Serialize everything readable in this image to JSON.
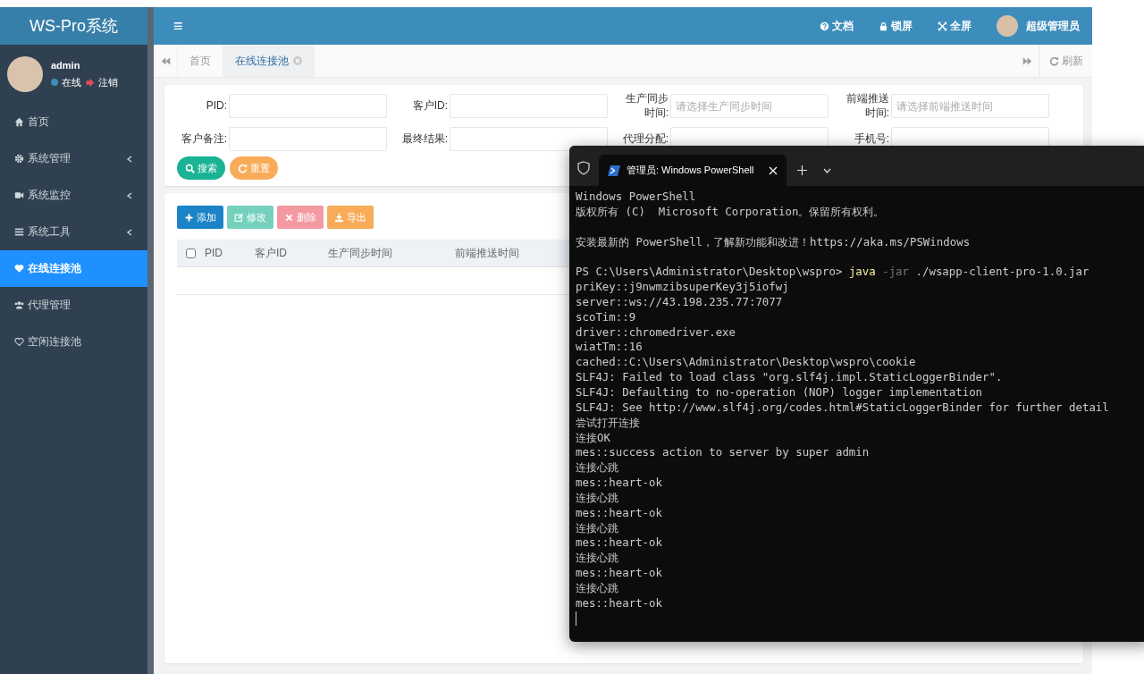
{
  "app": {
    "title": "WS-Pro系统"
  },
  "top_bar": {
    "menu_icon": "≡",
    "items": [
      {
        "kind": "docs",
        "label": "文档"
      },
      {
        "kind": "lock",
        "label": "锁屏"
      },
      {
        "kind": "fullscreen",
        "label": "全屏"
      },
      {
        "kind": "user",
        "label": "超级管理员"
      }
    ]
  },
  "user_panel": {
    "name": "admin",
    "status": "在线",
    "logout": "注销"
  },
  "sidebar": {
    "items": [
      {
        "kind": "home",
        "label": "首页",
        "expandable": false,
        "selected": false
      },
      {
        "kind": "gear",
        "label": "系统管理",
        "expandable": true,
        "selected": false
      },
      {
        "kind": "video",
        "label": "系统监控",
        "expandable": true,
        "selected": false
      },
      {
        "kind": "bars",
        "label": "系统工具",
        "expandable": true,
        "selected": false
      },
      {
        "kind": "heart",
        "label": "在线连接池",
        "expandable": false,
        "selected": true
      },
      {
        "kind": "users",
        "label": "代理管理",
        "expandable": false,
        "selected": false
      },
      {
        "kind": "heart-outline",
        "label": "空闲连接池",
        "expandable": false,
        "selected": false
      }
    ]
  },
  "page_tabs": {
    "tabs": [
      {
        "label": "首页",
        "selected": false,
        "closable": false
      },
      {
        "label": "在线连接池",
        "selected": true,
        "closable": true
      }
    ],
    "refresh": "刷新"
  },
  "search_form": {
    "fields": [
      {
        "label": "PID:"
      },
      {
        "label": "客户ID:"
      },
      {
        "label": "生产同步时间:",
        "placeholder": "请选择生产同步时间"
      },
      {
        "label": "前端推送时间:",
        "placeholder": "请选择前端推送时间"
      },
      {
        "label": "客户备注:"
      },
      {
        "label": "最终结果:"
      },
      {
        "label": "代理分配:"
      },
      {
        "label": "手机号:"
      }
    ],
    "buttons": [
      {
        "kind": "search",
        "label": "搜索"
      },
      {
        "kind": "reset",
        "label": "重置"
      }
    ]
  },
  "toolbar": {
    "buttons": [
      {
        "kind": "add",
        "label": "添加",
        "disabled": false
      },
      {
        "kind": "edit",
        "label": "修改",
        "disabled": true
      },
      {
        "kind": "delete",
        "label": "删除",
        "disabled": true
      },
      {
        "kind": "export",
        "label": "导出",
        "disabled": false
      }
    ]
  },
  "table": {
    "select_all_checked": false,
    "columns": [
      "PID",
      "客户ID",
      "生产同步时间",
      "前端推送时间"
    ]
  },
  "terminal": {
    "tab_title": "管理员: Windows PowerShell",
    "lines": [
      {
        "kind": "text",
        "text": "Windows PowerShell"
      },
      {
        "kind": "text",
        "text": "版权所有 (C)  Microsoft Corporation。保留所有权利。"
      },
      {
        "kind": "blank"
      },
      {
        "kind": "text",
        "text": "安装最新的 PowerShell，了解新功能和改进！https://aka.ms/PSWindows"
      },
      {
        "kind": "blank"
      },
      {
        "kind": "command",
        "prompt": "PS C:\\Users\\Administrator\\Desktop\\wspro>",
        "program": "java",
        "flag": "-jar",
        "args": "./wsapp-client-pro-1.0.jar"
      },
      {
        "kind": "text",
        "text": "priKey::j9nwmzibsuperKey3j5iofwj"
      },
      {
        "kind": "text",
        "text": "server::ws://43.198.235.77:7077"
      },
      {
        "kind": "text",
        "text": "scoTim::9"
      },
      {
        "kind": "text",
        "text": "driver::chromedriver.exe"
      },
      {
        "kind": "text",
        "text": "wiatTm::16"
      },
      {
        "kind": "text",
        "text": "cached::C:\\Users\\Administrator\\Desktop\\wspro\\cookie"
      },
      {
        "kind": "text",
        "text": "SLF4J: Failed to load class \"org.slf4j.impl.StaticLoggerBinder\"."
      },
      {
        "kind": "text",
        "text": "SLF4J: Defaulting to no-operation (NOP) logger implementation"
      },
      {
        "kind": "text",
        "text": "SLF4J: See http://www.slf4j.org/codes.html#StaticLoggerBinder for further detail"
      },
      {
        "kind": "text",
        "text": "尝试打开连接"
      },
      {
        "kind": "text",
        "text": "连接OK"
      },
      {
        "kind": "text",
        "text": "mes::success action to server by super admin"
      },
      {
        "kind": "text",
        "text": "连接心跳"
      },
      {
        "kind": "text",
        "text": "mes::heart-ok"
      },
      {
        "kind": "text",
        "text": "连接心跳"
      },
      {
        "kind": "text",
        "text": "mes::heart-ok"
      },
      {
        "kind": "text",
        "text": "连接心跳"
      },
      {
        "kind": "text",
        "text": "mes::heart-ok"
      },
      {
        "kind": "text",
        "text": "连接心跳"
      },
      {
        "kind": "text",
        "text": "mes::heart-ok"
      },
      {
        "kind": "text",
        "text": "连接心跳"
      },
      {
        "kind": "text",
        "text": "mes::heart-ok"
      },
      {
        "kind": "cursor"
      }
    ]
  }
}
